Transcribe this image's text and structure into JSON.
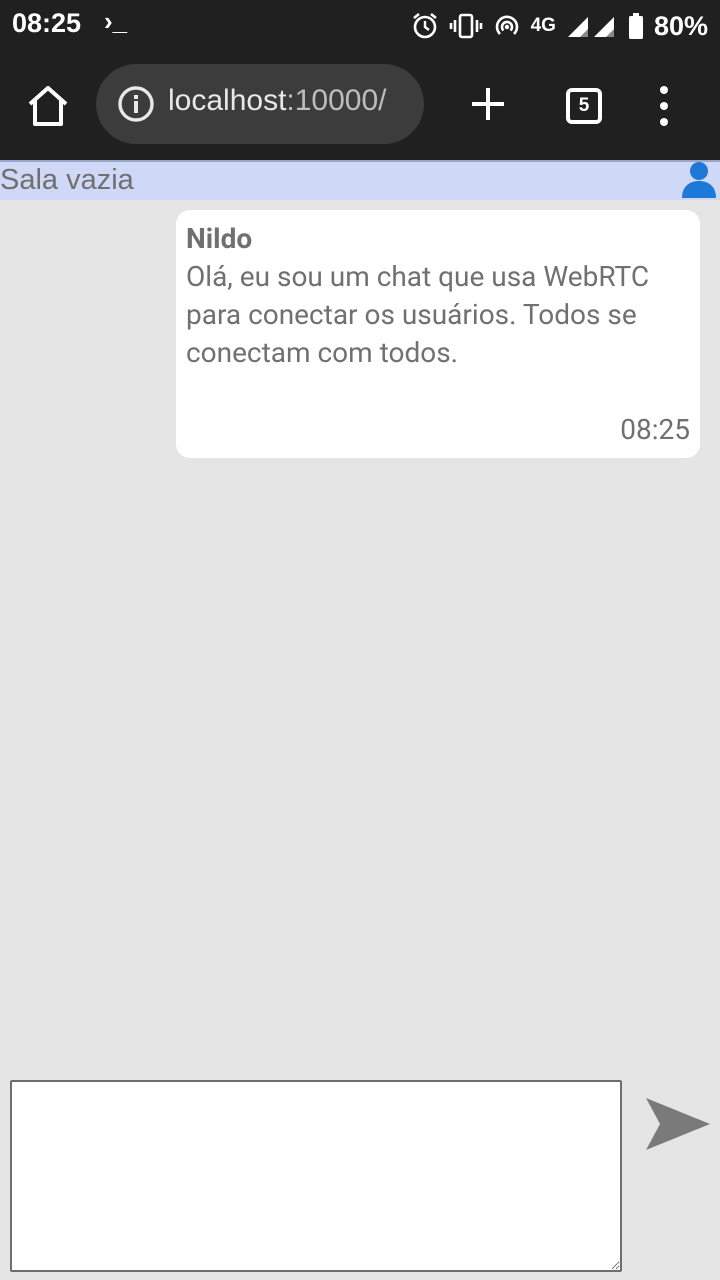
{
  "status_bar": {
    "time": "08:25",
    "terminal_glyph": "›_",
    "network": "4G",
    "battery": "80%"
  },
  "browser": {
    "url_host": "localhost",
    "url_port": ":10000/",
    "tab_count": "5"
  },
  "room": {
    "title": "Sala vazia"
  },
  "messages": [
    {
      "author": "Nildo",
      "text": "Olá, eu sou um chat que usa WebRTC para conectar os usuários. Todos se conectam com todos.",
      "time": "08:25"
    }
  ],
  "composer": {
    "value": "",
    "placeholder": ""
  },
  "colors": {
    "chat_background": "#e5e5e5",
    "room_header": "#cfd8f6",
    "user_icon": "#1e78d8",
    "send_icon": "#7a7a7a",
    "browser_chrome": "#202020"
  },
  "icons": [
    "terminal-icon",
    "alarm-icon",
    "vibrate-icon",
    "hotspot-icon",
    "signal-icon",
    "battery-icon",
    "home-icon",
    "info-icon",
    "plus-icon",
    "tabs-icon",
    "overflow-menu-icon",
    "user-icon",
    "send-icon"
  ]
}
